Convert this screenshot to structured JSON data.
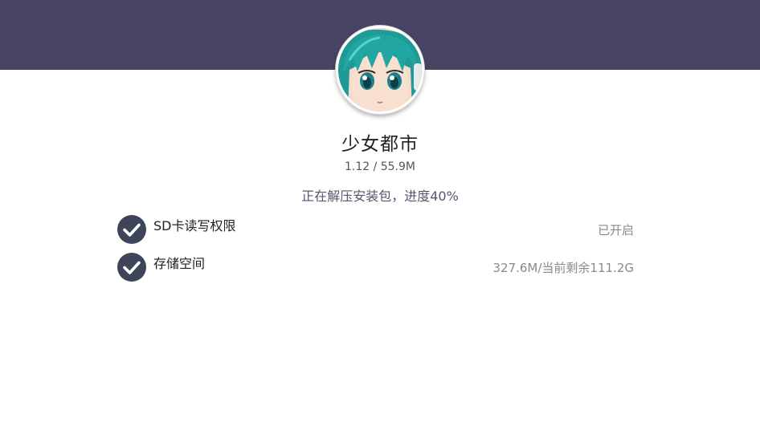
{
  "app": {
    "title": "少女都市",
    "version_size": "1.12 / 55.9M",
    "status": "正在解压安装包，进度40%",
    "progress": 0.4
  },
  "requirements": [
    {
      "label": "SD卡读写权限",
      "value": "已开启",
      "icon": "check-icon",
      "checked": true
    },
    {
      "label": "存储空间",
      "value": "327.6M/当前剩余111.2G",
      "icon": "check-icon",
      "checked": true
    }
  ],
  "colors": {
    "header": "#474563",
    "check_badge": "#3e4559",
    "status_text": "#55566e"
  }
}
